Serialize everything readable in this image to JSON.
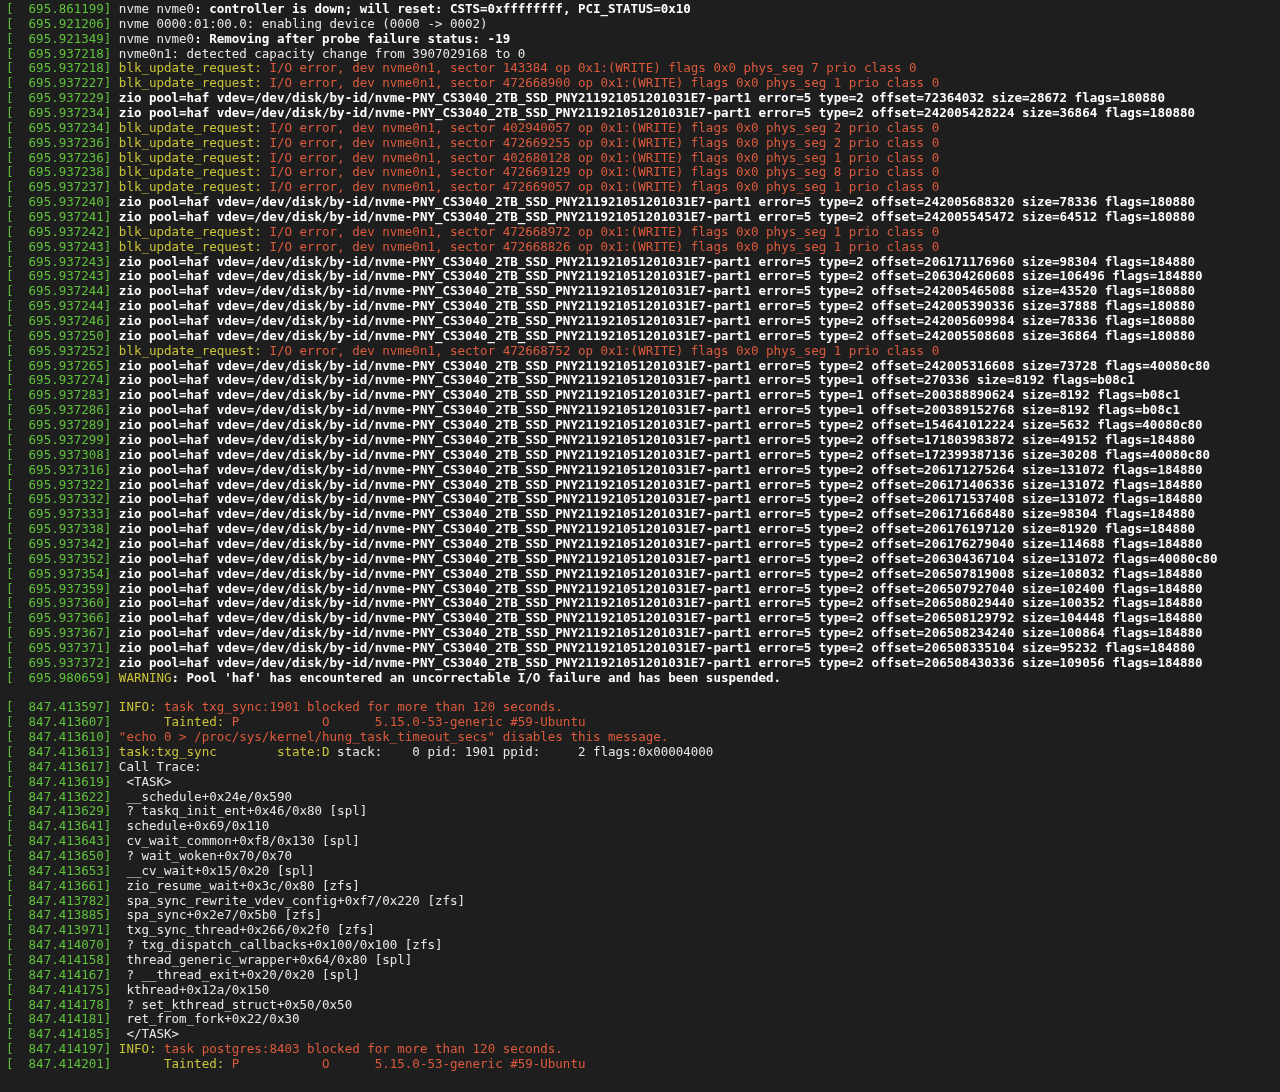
{
  "terminal": {
    "lines": [
      {
        "kind": "log",
        "stamp": "[  695.861199]",
        "parts": [
          {
            "kind": "plain",
            "text": "nvme nvme0"
          },
          {
            "kind": "bold",
            "text": ": controller is down; will reset: CSTS=0xffffffff, PCI_STATUS=0x10"
          }
        ]
      },
      {
        "kind": "log",
        "stamp": "[  695.921206]",
        "parts": [
          {
            "kind": "plain",
            "text": "nvme 0000:01:00.0: enabling device (0000 -> 0002)"
          }
        ]
      },
      {
        "kind": "log",
        "stamp": "[  695.921349]",
        "parts": [
          {
            "kind": "plain",
            "text": "nvme nvme0"
          },
          {
            "kind": "bold",
            "text": ": Removing after probe failure status: -19"
          }
        ]
      },
      {
        "kind": "log",
        "stamp": "[  695.937218]",
        "parts": [
          {
            "kind": "plain",
            "text": "nvme0n1: detected capacity change from 3907029168 to 0"
          }
        ]
      },
      {
        "kind": "log",
        "stamp": "[  695.937218]",
        "parts": [
          {
            "kind": "tag",
            "text": "blk_update_request:"
          },
          {
            "kind": "error",
            "text": " I/O error, dev nvme0n1, sector 143384 op 0x1:(WRITE) flags 0x0 phys_seg 7 prio class 0"
          }
        ]
      },
      {
        "kind": "log",
        "stamp": "[  695.937227]",
        "parts": [
          {
            "kind": "tag",
            "text": "blk_update_request:"
          },
          {
            "kind": "error",
            "text": " I/O error, dev nvme0n1, sector 472668900 op 0x1:(WRITE) flags 0x0 phys_seg 1 prio class 0"
          }
        ]
      },
      {
        "kind": "log",
        "stamp": "[  695.937229]",
        "parts": [
          {
            "kind": "bold",
            "text": "zio pool=haf vdev=/dev/disk/by-id/nvme-PNY_CS3040_2TB_SSD_PNY211921051201031E7-part1 error=5 type=2 offset=72364032 size=28672 flags=180880"
          }
        ]
      },
      {
        "kind": "log",
        "stamp": "[  695.937234]",
        "parts": [
          {
            "kind": "bold",
            "text": "zio pool=haf vdev=/dev/disk/by-id/nvme-PNY_CS3040_2TB_SSD_PNY211921051201031E7-part1 error=5 type=2 offset=242005428224 size=36864 flags=180880"
          }
        ]
      },
      {
        "kind": "log",
        "stamp": "[  695.937234]",
        "parts": [
          {
            "kind": "tag",
            "text": "blk_update_request:"
          },
          {
            "kind": "error",
            "text": " I/O error, dev nvme0n1, sector 402940057 op 0x1:(WRITE) flags 0x0 phys_seg 2 prio class 0"
          }
        ]
      },
      {
        "kind": "log",
        "stamp": "[  695.937236]",
        "parts": [
          {
            "kind": "tag",
            "text": "blk_update_request:"
          },
          {
            "kind": "error",
            "text": " I/O error, dev nvme0n1, sector 472669255 op 0x1:(WRITE) flags 0x0 phys_seg 2 prio class 0"
          }
        ]
      },
      {
        "kind": "log",
        "stamp": "[  695.937236]",
        "parts": [
          {
            "kind": "tag",
            "text": "blk_update_request:"
          },
          {
            "kind": "error",
            "text": " I/O error, dev nvme0n1, sector 402680128 op 0x1:(WRITE) flags 0x0 phys_seg 1 prio class 0"
          }
        ]
      },
      {
        "kind": "log",
        "stamp": "[  695.937238]",
        "parts": [
          {
            "kind": "tag",
            "text": "blk_update_request:"
          },
          {
            "kind": "error",
            "text": " I/O error, dev nvme0n1, sector 472669129 op 0x1:(WRITE) flags 0x0 phys_seg 8 prio class 0"
          }
        ]
      },
      {
        "kind": "log",
        "stamp": "[  695.937237]",
        "parts": [
          {
            "kind": "tag",
            "text": "blk_update_request:"
          },
          {
            "kind": "error",
            "text": " I/O error, dev nvme0n1, sector 472669057 op 0x1:(WRITE) flags 0x0 phys_seg 1 prio class 0"
          }
        ]
      },
      {
        "kind": "log",
        "stamp": "[  695.937240]",
        "parts": [
          {
            "kind": "bold",
            "text": "zio pool=haf vdev=/dev/disk/by-id/nvme-PNY_CS3040_2TB_SSD_PNY211921051201031E7-part1 error=5 type=2 offset=242005688320 size=78336 flags=180880"
          }
        ]
      },
      {
        "kind": "log",
        "stamp": "[  695.937241]",
        "parts": [
          {
            "kind": "bold",
            "text": "zio pool=haf vdev=/dev/disk/by-id/nvme-PNY_CS3040_2TB_SSD_PNY211921051201031E7-part1 error=5 type=2 offset=242005545472 size=64512 flags=180880"
          }
        ]
      },
      {
        "kind": "log",
        "stamp": "[  695.937242]",
        "parts": [
          {
            "kind": "tag",
            "text": "blk_update_request:"
          },
          {
            "kind": "error",
            "text": " I/O error, dev nvme0n1, sector 472668972 op 0x1:(WRITE) flags 0x0 phys_seg 1 prio class 0"
          }
        ]
      },
      {
        "kind": "log",
        "stamp": "[  695.937243]",
        "parts": [
          {
            "kind": "tag",
            "text": "blk_update_request:"
          },
          {
            "kind": "error",
            "text": " I/O error, dev nvme0n1, sector 472668826 op 0x1:(WRITE) flags 0x0 phys_seg 1 prio class 0"
          }
        ]
      },
      {
        "kind": "log",
        "stamp": "[  695.937243]",
        "parts": [
          {
            "kind": "bold",
            "text": "zio pool=haf vdev=/dev/disk/by-id/nvme-PNY_CS3040_2TB_SSD_PNY211921051201031E7-part1 error=5 type=2 offset=206171176960 size=98304 flags=184880"
          }
        ]
      },
      {
        "kind": "log",
        "stamp": "[  695.937243]",
        "parts": [
          {
            "kind": "bold",
            "text": "zio pool=haf vdev=/dev/disk/by-id/nvme-PNY_CS3040_2TB_SSD_PNY211921051201031E7-part1 error=5 type=2 offset=206304260608 size=106496 flags=184880"
          }
        ]
      },
      {
        "kind": "log",
        "stamp": "[  695.937244]",
        "parts": [
          {
            "kind": "bold",
            "text": "zio pool=haf vdev=/dev/disk/by-id/nvme-PNY_CS3040_2TB_SSD_PNY211921051201031E7-part1 error=5 type=2 offset=242005465088 size=43520 flags=180880"
          }
        ]
      },
      {
        "kind": "log",
        "stamp": "[  695.937244]",
        "parts": [
          {
            "kind": "bold",
            "text": "zio pool=haf vdev=/dev/disk/by-id/nvme-PNY_CS3040_2TB_SSD_PNY211921051201031E7-part1 error=5 type=2 offset=242005390336 size=37888 flags=180880"
          }
        ]
      },
      {
        "kind": "log",
        "stamp": "[  695.937246]",
        "parts": [
          {
            "kind": "bold",
            "text": "zio pool=haf vdev=/dev/disk/by-id/nvme-PNY_CS3040_2TB_SSD_PNY211921051201031E7-part1 error=5 type=2 offset=242005609984 size=78336 flags=180880"
          }
        ]
      },
      {
        "kind": "log",
        "stamp": "[  695.937250]",
        "parts": [
          {
            "kind": "bold",
            "text": "zio pool=haf vdev=/dev/disk/by-id/nvme-PNY_CS3040_2TB_SSD_PNY211921051201031E7-part1 error=5 type=2 offset=242005508608 size=36864 flags=180880"
          }
        ]
      },
      {
        "kind": "log",
        "stamp": "[  695.937252]",
        "parts": [
          {
            "kind": "tag",
            "text": "blk_update_request:"
          },
          {
            "kind": "error",
            "text": " I/O error, dev nvme0n1, sector 472668752 op 0x1:(WRITE) flags 0x0 phys_seg 1 prio class 0"
          }
        ]
      },
      {
        "kind": "log",
        "stamp": "[  695.937265]",
        "parts": [
          {
            "kind": "bold",
            "text": "zio pool=haf vdev=/dev/disk/by-id/nvme-PNY_CS3040_2TB_SSD_PNY211921051201031E7-part1 error=5 type=2 offset=242005316608 size=73728 flags=40080c80"
          }
        ]
      },
      {
        "kind": "log",
        "stamp": "[  695.937274]",
        "parts": [
          {
            "kind": "bold",
            "text": "zio pool=haf vdev=/dev/disk/by-id/nvme-PNY_CS3040_2TB_SSD_PNY211921051201031E7-part1 error=5 type=1 offset=270336 size=8192 flags=b08c1"
          }
        ]
      },
      {
        "kind": "log",
        "stamp": "[  695.937283]",
        "parts": [
          {
            "kind": "bold",
            "text": "zio pool=haf vdev=/dev/disk/by-id/nvme-PNY_CS3040_2TB_SSD_PNY211921051201031E7-part1 error=5 type=1 offset=200388890624 size=8192 flags=b08c1"
          }
        ]
      },
      {
        "kind": "log",
        "stamp": "[  695.937286]",
        "parts": [
          {
            "kind": "bold",
            "text": "zio pool=haf vdev=/dev/disk/by-id/nvme-PNY_CS3040_2TB_SSD_PNY211921051201031E7-part1 error=5 type=1 offset=200389152768 size=8192 flags=b08c1"
          }
        ]
      },
      {
        "kind": "log",
        "stamp": "[  695.937289]",
        "parts": [
          {
            "kind": "bold",
            "text": "zio pool=haf vdev=/dev/disk/by-id/nvme-PNY_CS3040_2TB_SSD_PNY211921051201031E7-part1 error=5 type=2 offset=154641012224 size=5632 flags=40080c80"
          }
        ]
      },
      {
        "kind": "log",
        "stamp": "[  695.937299]",
        "parts": [
          {
            "kind": "bold",
            "text": "zio pool=haf vdev=/dev/disk/by-id/nvme-PNY_CS3040_2TB_SSD_PNY211921051201031E7-part1 error=5 type=2 offset=171803983872 size=49152 flags=184880"
          }
        ]
      },
      {
        "kind": "log",
        "stamp": "[  695.937308]",
        "parts": [
          {
            "kind": "bold",
            "text": "zio pool=haf vdev=/dev/disk/by-id/nvme-PNY_CS3040_2TB_SSD_PNY211921051201031E7-part1 error=5 type=2 offset=172399387136 size=30208 flags=40080c80"
          }
        ]
      },
      {
        "kind": "log",
        "stamp": "[  695.937316]",
        "parts": [
          {
            "kind": "bold",
            "text": "zio pool=haf vdev=/dev/disk/by-id/nvme-PNY_CS3040_2TB_SSD_PNY211921051201031E7-part1 error=5 type=2 offset=206171275264 size=131072 flags=184880"
          }
        ]
      },
      {
        "kind": "log",
        "stamp": "[  695.937322]",
        "parts": [
          {
            "kind": "bold",
            "text": "zio pool=haf vdev=/dev/disk/by-id/nvme-PNY_CS3040_2TB_SSD_PNY211921051201031E7-part1 error=5 type=2 offset=206171406336 size=131072 flags=184880"
          }
        ]
      },
      {
        "kind": "log",
        "stamp": "[  695.937332]",
        "parts": [
          {
            "kind": "bold",
            "text": "zio pool=haf vdev=/dev/disk/by-id/nvme-PNY_CS3040_2TB_SSD_PNY211921051201031E7-part1 error=5 type=2 offset=206171537408 size=131072 flags=184880"
          }
        ]
      },
      {
        "kind": "log",
        "stamp": "[  695.937333]",
        "parts": [
          {
            "kind": "bold",
            "text": "zio pool=haf vdev=/dev/disk/by-id/nvme-PNY_CS3040_2TB_SSD_PNY211921051201031E7-part1 error=5 type=2 offset=206171668480 size=98304 flags=184880"
          }
        ]
      },
      {
        "kind": "log",
        "stamp": "[  695.937338]",
        "parts": [
          {
            "kind": "bold",
            "text": "zio pool=haf vdev=/dev/disk/by-id/nvme-PNY_CS3040_2TB_SSD_PNY211921051201031E7-part1 error=5 type=2 offset=206176197120 size=81920 flags=184880"
          }
        ]
      },
      {
        "kind": "log",
        "stamp": "[  695.937342]",
        "parts": [
          {
            "kind": "bold",
            "text": "zio pool=haf vdev=/dev/disk/by-id/nvme-PNY_CS3040_2TB_SSD_PNY211921051201031E7-part1 error=5 type=2 offset=206176279040 size=114688 flags=184880"
          }
        ]
      },
      {
        "kind": "log",
        "stamp": "[  695.937352]",
        "parts": [
          {
            "kind": "bold",
            "text": "zio pool=haf vdev=/dev/disk/by-id/nvme-PNY_CS3040_2TB_SSD_PNY211921051201031E7-part1 error=5 type=2 offset=206304367104 size=131072 flags=40080c80"
          }
        ]
      },
      {
        "kind": "log",
        "stamp": "[  695.937354]",
        "parts": [
          {
            "kind": "bold",
            "text": "zio pool=haf vdev=/dev/disk/by-id/nvme-PNY_CS3040_2TB_SSD_PNY211921051201031E7-part1 error=5 type=2 offset=206507819008 size=108032 flags=184880"
          }
        ]
      },
      {
        "kind": "log",
        "stamp": "[  695.937359]",
        "parts": [
          {
            "kind": "bold",
            "text": "zio pool=haf vdev=/dev/disk/by-id/nvme-PNY_CS3040_2TB_SSD_PNY211921051201031E7-part1 error=5 type=2 offset=206507927040 size=102400 flags=184880"
          }
        ]
      },
      {
        "kind": "log",
        "stamp": "[  695.937360]",
        "parts": [
          {
            "kind": "bold",
            "text": "zio pool=haf vdev=/dev/disk/by-id/nvme-PNY_CS3040_2TB_SSD_PNY211921051201031E7-part1 error=5 type=2 offset=206508029440 size=100352 flags=184880"
          }
        ]
      },
      {
        "kind": "log",
        "stamp": "[  695.937366]",
        "parts": [
          {
            "kind": "bold",
            "text": "zio pool=haf vdev=/dev/disk/by-id/nvme-PNY_CS3040_2TB_SSD_PNY211921051201031E7-part1 error=5 type=2 offset=206508129792 size=104448 flags=184880"
          }
        ]
      },
      {
        "kind": "log",
        "stamp": "[  695.937367]",
        "parts": [
          {
            "kind": "bold",
            "text": "zio pool=haf vdev=/dev/disk/by-id/nvme-PNY_CS3040_2TB_SSD_PNY211921051201031E7-part1 error=5 type=2 offset=206508234240 size=100864 flags=184880"
          }
        ]
      },
      {
        "kind": "log",
        "stamp": "[  695.937371]",
        "parts": [
          {
            "kind": "bold",
            "text": "zio pool=haf vdev=/dev/disk/by-id/nvme-PNY_CS3040_2TB_SSD_PNY211921051201031E7-part1 error=5 type=2 offset=206508335104 size=95232 flags=184880"
          }
        ]
      },
      {
        "kind": "log",
        "stamp": "[  695.937372]",
        "parts": [
          {
            "kind": "bold",
            "text": "zio pool=haf vdev=/dev/disk/by-id/nvme-PNY_CS3040_2TB_SSD_PNY211921051201031E7-part1 error=5 type=2 offset=206508430336 size=109056 flags=184880"
          }
        ]
      },
      {
        "kind": "log",
        "stamp": "[  695.980659]",
        "parts": [
          {
            "kind": "tag",
            "text": "WARNING"
          },
          {
            "kind": "bold",
            "text": ": Pool 'haf' has encountered an uncorrectable I/O failure and has been suspended."
          }
        ]
      },
      {
        "kind": "blank"
      },
      {
        "kind": "log",
        "stamp": "[  847.413597]",
        "parts": [
          {
            "kind": "tag",
            "text": "INFO:"
          },
          {
            "kind": "error",
            "text": " task txg_sync:1901 blocked for more than 120 seconds."
          }
        ]
      },
      {
        "kind": "log",
        "stamp": "[  847.413607]",
        "parts": [
          {
            "kind": "tag",
            "text": "      Tainted:"
          },
          {
            "kind": "error",
            "text": " P           O      5.15.0-53-generic #59-Ubuntu"
          }
        ]
      },
      {
        "kind": "log",
        "stamp": "[  847.413610]",
        "parts": [
          {
            "kind": "error",
            "text": "\"echo 0 > /proc/sys/kernel/hung_task_timeout_secs\" disables this message."
          }
        ]
      },
      {
        "kind": "log",
        "stamp": "[  847.413613]",
        "parts": [
          {
            "kind": "tag",
            "text": "task:txg_sync        state:D"
          },
          {
            "kind": "plain",
            "text": " stack:    0 pid: 1901 ppid:     2 flags:0x00004000"
          }
        ]
      },
      {
        "kind": "log",
        "stamp": "[  847.413617]",
        "parts": [
          {
            "kind": "plain",
            "text": "Call Trace:"
          }
        ]
      },
      {
        "kind": "log",
        "stamp": "[  847.413619]",
        "parts": [
          {
            "kind": "plain",
            "text": " <TASK>"
          }
        ]
      },
      {
        "kind": "log",
        "stamp": "[  847.413622]",
        "parts": [
          {
            "kind": "plain",
            "text": " __schedule+0x24e/0x590"
          }
        ]
      },
      {
        "kind": "log",
        "stamp": "[  847.413629]",
        "parts": [
          {
            "kind": "plain",
            "text": " ? taskq_init_ent+0x46/0x80 [spl]"
          }
        ]
      },
      {
        "kind": "log",
        "stamp": "[  847.413641]",
        "parts": [
          {
            "kind": "plain",
            "text": " schedule+0x69/0x110"
          }
        ]
      },
      {
        "kind": "log",
        "stamp": "[  847.413643]",
        "parts": [
          {
            "kind": "plain",
            "text": " cv_wait_common+0xf8/0x130 [spl]"
          }
        ]
      },
      {
        "kind": "log",
        "stamp": "[  847.413650]",
        "parts": [
          {
            "kind": "plain",
            "text": " ? wait_woken+0x70/0x70"
          }
        ]
      },
      {
        "kind": "log",
        "stamp": "[  847.413653]",
        "parts": [
          {
            "kind": "plain",
            "text": " __cv_wait+0x15/0x20 [spl]"
          }
        ]
      },
      {
        "kind": "log",
        "stamp": "[  847.413661]",
        "parts": [
          {
            "kind": "plain",
            "text": " zio_resume_wait+0x3c/0x80 [zfs]"
          }
        ]
      },
      {
        "kind": "log",
        "stamp": "[  847.413782]",
        "parts": [
          {
            "kind": "plain",
            "text": " spa_sync_rewrite_vdev_config+0xf7/0x220 [zfs]"
          }
        ]
      },
      {
        "kind": "log",
        "stamp": "[  847.413885]",
        "parts": [
          {
            "kind": "plain",
            "text": " spa_sync+0x2e7/0x5b0 [zfs]"
          }
        ]
      },
      {
        "kind": "log",
        "stamp": "[  847.413971]",
        "parts": [
          {
            "kind": "plain",
            "text": " txg_sync_thread+0x266/0x2f0 [zfs]"
          }
        ]
      },
      {
        "kind": "log",
        "stamp": "[  847.414070]",
        "parts": [
          {
            "kind": "plain",
            "text": " ? txg_dispatch_callbacks+0x100/0x100 [zfs]"
          }
        ]
      },
      {
        "kind": "log",
        "stamp": "[  847.414158]",
        "parts": [
          {
            "kind": "plain",
            "text": " thread_generic_wrapper+0x64/0x80 [spl]"
          }
        ]
      },
      {
        "kind": "log",
        "stamp": "[  847.414167]",
        "parts": [
          {
            "kind": "plain",
            "text": " ? __thread_exit+0x20/0x20 [spl]"
          }
        ]
      },
      {
        "kind": "log",
        "stamp": "[  847.414175]",
        "parts": [
          {
            "kind": "plain",
            "text": " kthread+0x12a/0x150"
          }
        ]
      },
      {
        "kind": "log",
        "stamp": "[  847.414178]",
        "parts": [
          {
            "kind": "plain",
            "text": " ? set_kthread_struct+0x50/0x50"
          }
        ]
      },
      {
        "kind": "log",
        "stamp": "[  847.414181]",
        "parts": [
          {
            "kind": "plain",
            "text": " ret_from_fork+0x22/0x30"
          }
        ]
      },
      {
        "kind": "log",
        "stamp": "[  847.414185]",
        "parts": [
          {
            "kind": "plain",
            "text": " </TASK>"
          }
        ]
      },
      {
        "kind": "log",
        "stamp": "[  847.414197]",
        "parts": [
          {
            "kind": "tag",
            "text": "INFO:"
          },
          {
            "kind": "error",
            "text": " task postgres:8403 blocked for more than 120 seconds."
          }
        ]
      },
      {
        "kind": "log",
        "stamp": "[  847.414201]",
        "parts": [
          {
            "kind": "tag",
            "text": "      Tainted:"
          },
          {
            "kind": "error",
            "text": " P           O      5.15.0-53-generic #59-Ubuntu"
          }
        ]
      }
    ]
  }
}
